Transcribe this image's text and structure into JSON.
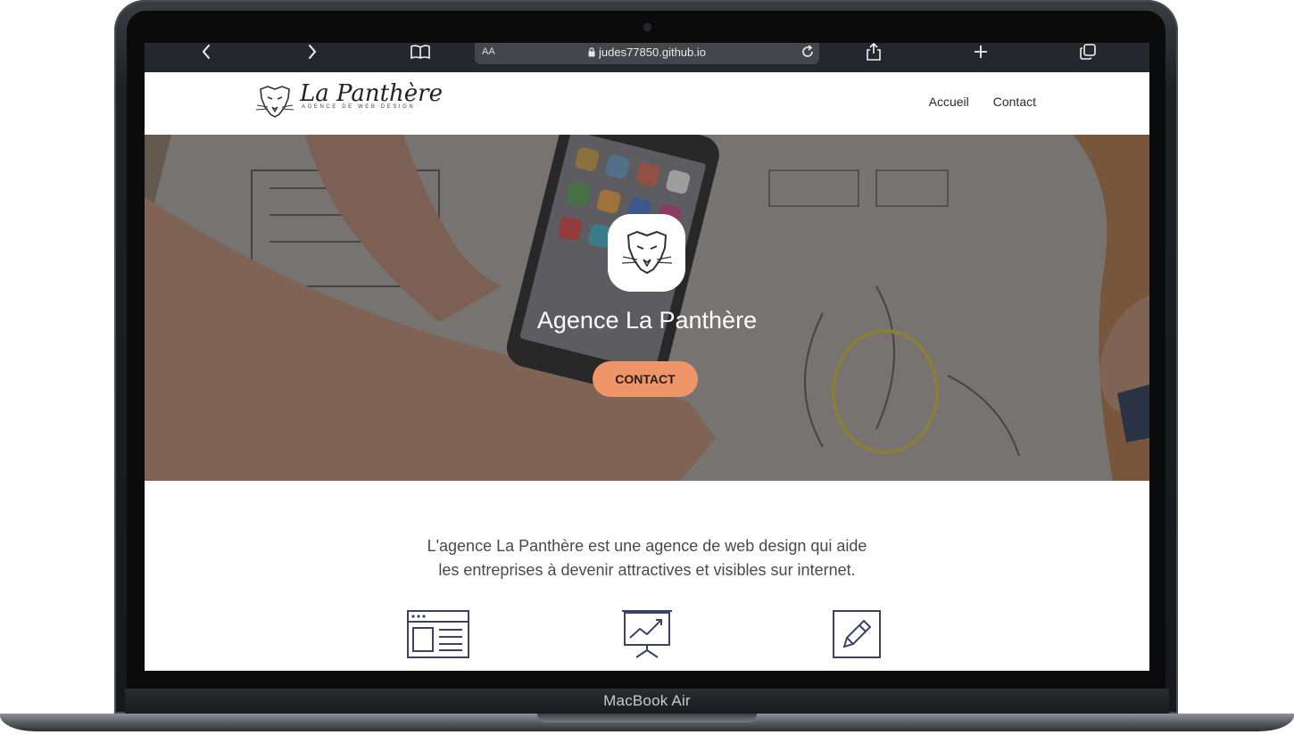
{
  "device": {
    "label": "MacBook Air"
  },
  "browser": {
    "url": "judes77850.github.io",
    "text_size_label": "AA",
    "icons": [
      "chevron-left-icon",
      "chevron-right-icon",
      "book-icon",
      "lock-icon",
      "reload-icon",
      "share-icon",
      "plus-icon",
      "tabs-icon"
    ]
  },
  "site": {
    "logo_text": "La Panthère",
    "logo_tagline": "AGENCE DE WEB DESIGN",
    "nav": [
      {
        "label": "Accueil"
      },
      {
        "label": "Contact"
      }
    ],
    "hero": {
      "title": "Agence La Panthère",
      "cta_label": "CONTACT"
    },
    "intro": {
      "line1": "L'agence La Panthère est une agence de web design qui aide",
      "line2": "les entreprises à devenir attractives et visibles sur internet."
    },
    "features": [
      {
        "icon": "webpage-layout-icon"
      },
      {
        "icon": "presentation-chart-icon"
      },
      {
        "icon": "pencil-edit-icon"
      }
    ]
  },
  "colors": {
    "cta": "#f0946a",
    "icon_stroke": "#3d4263",
    "browser_bar": "#24272b"
  }
}
